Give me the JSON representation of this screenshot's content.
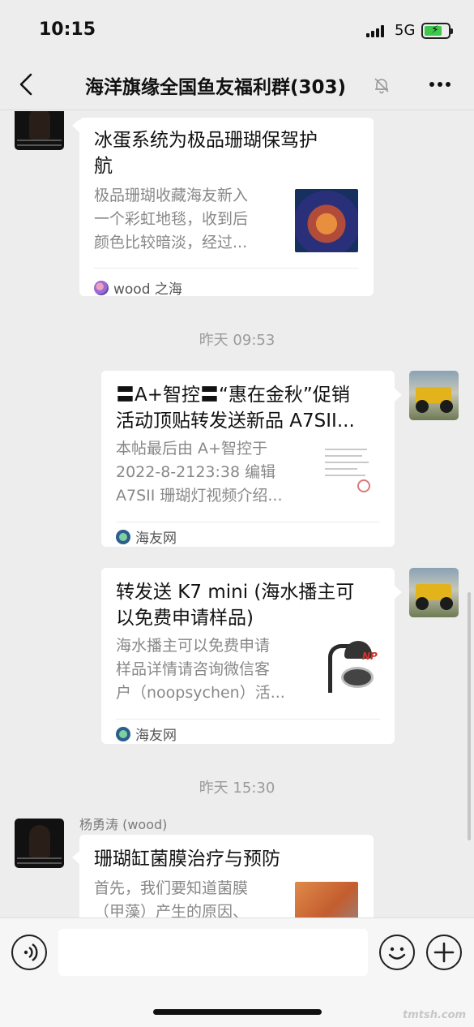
{
  "status_bar": {
    "time": "10:15",
    "network": "5G",
    "battery_level": 0.75
  },
  "nav": {
    "title": "海洋旗缘全国鱼友福利群(303)"
  },
  "messages": {
    "m1": {
      "title_lines": [
        "冰蛋系统为极品珊瑚保驾护",
        "航"
      ],
      "desc_lines": [
        "极品珊瑚收藏海友新入",
        "一个彩虹地毯，收到后",
        "颜色比较暗淡，经过..."
      ],
      "source": "wood 之海"
    },
    "ts1": "昨天 09:53",
    "m2": {
      "title_lines": [
        "〓A+智控〓“惠在金秋”促销",
        "活动顶贴转发送新品 A7SII..."
      ],
      "desc_lines": [
        "本帖最后由 A+智控于",
        "2022-8-2123:38 编辑",
        "A7SII 珊瑚灯视频介绍..."
      ],
      "source": "海友网"
    },
    "m3": {
      "title_lines": [
        "转发送 K7 mini (海水播主可",
        "以免费申请样品)"
      ],
      "desc_lines": [
        "海水播主可以免费申请",
        "样品详情请咨询微信客",
        "户（noopsychen）活..."
      ],
      "source": "海友网",
      "thumb_brand": "NP"
    },
    "ts2": "昨天 15:30",
    "m4": {
      "sender": "杨勇涛 (wood)",
      "title_lines": [
        "珊瑚缸菌膜治疗与预防"
      ],
      "desc_lines": [
        "首先，我们要知道菌膜",
        "（甲藻）产生的原因、"
      ]
    }
  },
  "input": {
    "placeholder": ""
  },
  "watermark": "tmtsh.com"
}
